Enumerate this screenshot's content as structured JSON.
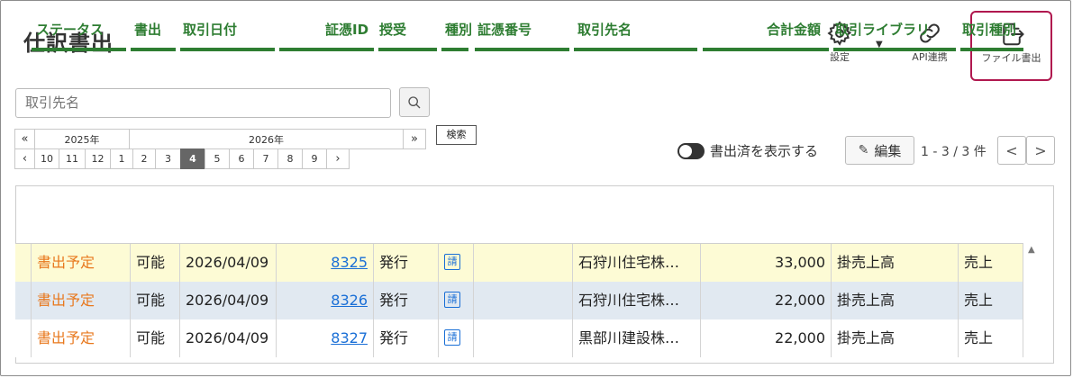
{
  "page": {
    "title": "仕訳書出"
  },
  "toolbar": {
    "settings_label": "設定",
    "api_label": "API連携",
    "export_label": "ファイル書出",
    "accent_color": "#b0184f"
  },
  "search": {
    "placeholder": "取引先名",
    "button_label": "検索"
  },
  "calendar": {
    "year_prev": "2025年",
    "year_current": "2026年",
    "prev_year_nav": "«",
    "next_year_nav": "»",
    "prev_month_nav": "‹",
    "next_month_nav": "›",
    "months": [
      "10",
      "11",
      "12",
      "1",
      "2",
      "3",
      "4",
      "5",
      "6",
      "7",
      "8",
      "9"
    ],
    "selected_month": "4"
  },
  "controls": {
    "toggle_label": "書出済を表示する",
    "edit_label": "編集",
    "page_info": "1 - 3 / 3 件",
    "prev_page": "<",
    "next_page": ">"
  },
  "table": {
    "header_color": "#2e7d32",
    "columns": [
      "ステータス",
      "書出",
      "取引日付",
      "証憑ID",
      "授受",
      "種別",
      "証憑番号",
      "取引先名",
      "合計金額",
      "取引ライブラリ",
      "取引種別"
    ],
    "rows": [
      {
        "status": "書出予定",
        "export": "可能",
        "date": "2026/04/09",
        "voucher_id": "8325",
        "direction": "発行",
        "kind_icon": "請",
        "voucher_no": "",
        "partner": "石狩川住宅株…",
        "amount": "33,000",
        "library": "掛売上高",
        "type": "売上"
      },
      {
        "status": "書出予定",
        "export": "可能",
        "date": "2026/04/09",
        "voucher_id": "8326",
        "direction": "発行",
        "kind_icon": "請",
        "voucher_no": "",
        "partner": "石狩川住宅株…",
        "amount": "22,000",
        "library": "掛売上高",
        "type": "売上"
      },
      {
        "status": "書出予定",
        "export": "可能",
        "date": "2026/04/09",
        "voucher_id": "8327",
        "direction": "発行",
        "kind_icon": "請",
        "voucher_no": "",
        "partner": "黒部川建設株…",
        "amount": "22,000",
        "library": "掛売上高",
        "type": "売上"
      }
    ]
  }
}
